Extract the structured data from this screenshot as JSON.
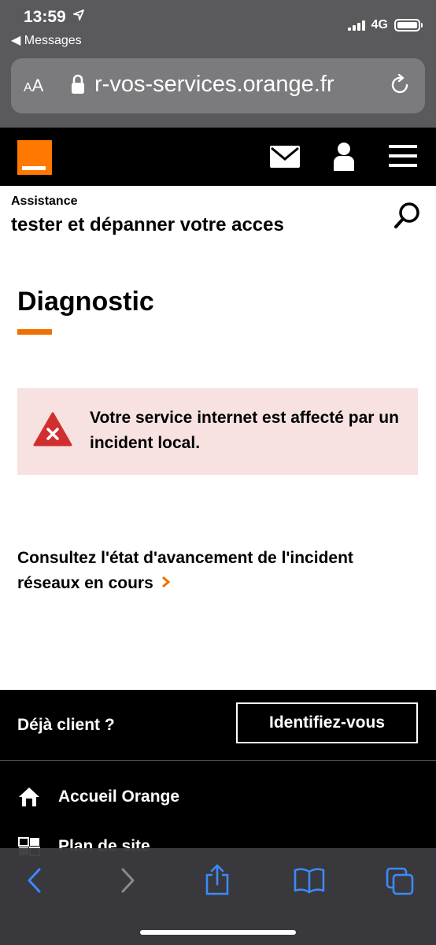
{
  "status_bar": {
    "time": "13:59",
    "back_label": "◀ Messages",
    "network": "4G"
  },
  "browser": {
    "text_size_label_small": "A",
    "text_size_label_large": "A",
    "url": "r-vos-services.orange.fr"
  },
  "header": {
    "logo": "orange-logo",
    "icons": [
      "mail-icon",
      "user-icon",
      "menu-icon"
    ]
  },
  "page": {
    "breadcrumb": "Assistance",
    "subtitle": "tester et dépanner votre acces",
    "title": "Diagnostic",
    "alert_message": "Votre service internet est affecté par un incident local.",
    "incident_link": "Consultez l'état d'avancement de l'incident réseaux en cours"
  },
  "footer": {
    "question": "Déjà client ?",
    "login_button": "Identifiez-vous",
    "links": [
      {
        "label": "Accueil Orange",
        "icon": "home-icon"
      },
      {
        "label": "Plan de site",
        "icon": "sitemap-icon"
      }
    ]
  },
  "colors": {
    "orange": "#ff7900",
    "alert_bg": "#f8e1e1",
    "alert_red": "#d12f2f",
    "safari_blue": "#3d8af7"
  }
}
